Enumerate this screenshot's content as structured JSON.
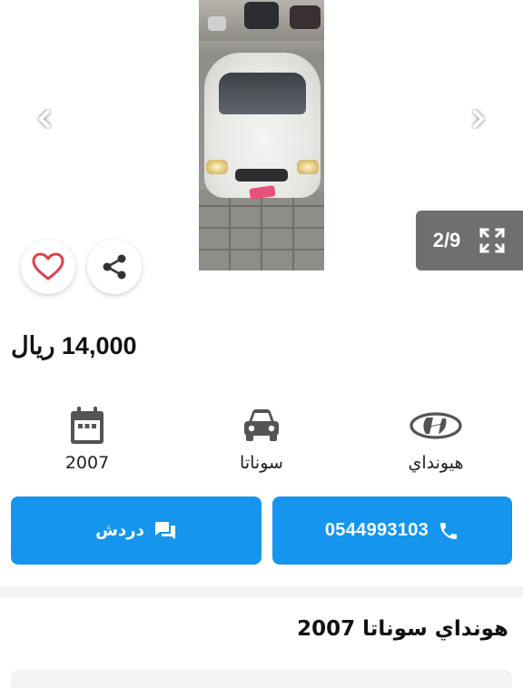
{
  "gallery": {
    "counter": "2/9",
    "photo_subject": "white sedan car photo"
  },
  "price": {
    "text": "14,000 ريال"
  },
  "specs": {
    "year": "2007",
    "model": "سوناتا",
    "brand": "هيونداي"
  },
  "actions": {
    "chat_label": "دردش",
    "phone_label": "0544993103"
  },
  "listing": {
    "title": "هونداي سوناتا 2007"
  },
  "colors": {
    "primary": "#1595ee",
    "heart": "#e0404c",
    "counter_bg": "#6f6f6f",
    "icon_gray": "#545454"
  },
  "icons": [
    "chevron-left-icon",
    "chevron-right-icon",
    "fullscreen-icon",
    "heart-icon",
    "share-icon",
    "calendar-icon",
    "car-icon",
    "hyundai-logo-icon",
    "chat-icon",
    "phone-icon"
  ]
}
